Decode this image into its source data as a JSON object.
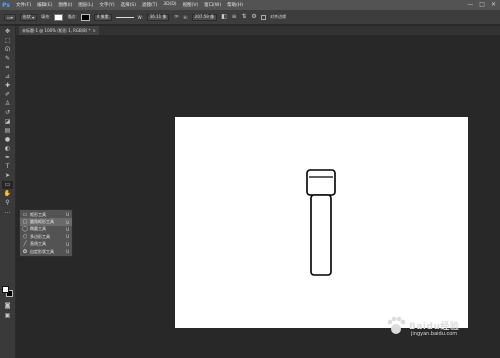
{
  "app": {
    "logo": "Ps"
  },
  "menu": [
    "文件(F)",
    "编辑(E)",
    "图像(I)",
    "图层(L)",
    "文字(Y)",
    "选择(S)",
    "滤镜(T)",
    "3D(D)",
    "视图(V)",
    "窗口(W)",
    "帮助(H)"
  ],
  "window_controls": {
    "minimize": "—",
    "maximize": "□",
    "close": "✕"
  },
  "options": {
    "mode": "形状",
    "fill_label": "填充:",
    "stroke_label": "描边:",
    "stroke_width": "4 像素",
    "w_label": "W:",
    "w_value": "36.11 像",
    "h_label": "H:",
    "h_value": "207.59 像",
    "align_edges": "对齐边缘"
  },
  "document": {
    "tab_title": "未标题-1 @ 100% (矩形 1, RGB/8) *",
    "tab_close": "×"
  },
  "flyout": [
    {
      "label": "矩形工具",
      "key": "U",
      "icon": "rectangle-icon"
    },
    {
      "label": "圆角矩形工具",
      "key": "U",
      "icon": "rounded-rectangle-icon",
      "selected": true
    },
    {
      "label": "椭圆工具",
      "key": "U",
      "icon": "ellipse-icon"
    },
    {
      "label": "多边形工具",
      "key": "U",
      "icon": "polygon-icon"
    },
    {
      "label": "直线工具",
      "key": "U",
      "icon": "line-icon"
    },
    {
      "label": "自定形状工具",
      "key": "U",
      "icon": "custom-shape-icon"
    }
  ],
  "watermark": {
    "text": "Baidu经验",
    "url": "jingyan.baidu.com"
  },
  "colors": {
    "foreground": "#ffffff",
    "background": "#000000",
    "canvas": "#ffffff"
  }
}
